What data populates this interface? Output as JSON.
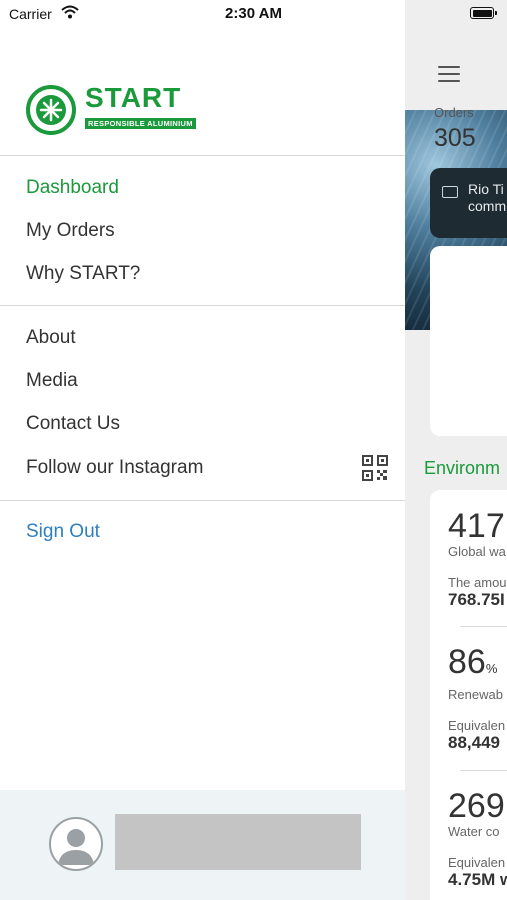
{
  "status_bar": {
    "carrier": "Carrier",
    "time": "2:30 AM"
  },
  "drawer": {
    "logo": {
      "name": "START",
      "tagline": "RESPONSIBLE ALUMINIUM",
      "brand_color": "#1a9a3a"
    },
    "primary_items": [
      {
        "label": "Dashboard",
        "active": true
      },
      {
        "label": "My Orders"
      },
      {
        "label": "Why START?"
      }
    ],
    "secondary_items": [
      {
        "label": "About"
      },
      {
        "label": "Media"
      },
      {
        "label": "Contact Us"
      },
      {
        "label": "Follow our Instagram",
        "icon": "qr-code-icon"
      }
    ],
    "sign_out": {
      "label": "Sign Out",
      "color": "#2f7fbf"
    }
  },
  "background": {
    "banner_text": [
      "Rio Ti",
      "comm"
    ],
    "orders": {
      "label": "Orders",
      "value": "305"
    },
    "environment_title": "Environm",
    "stats": [
      {
        "big": "417",
        "unit": "",
        "sub": "Global wa",
        "label": "The amou",
        "value": "768.75I"
      },
      {
        "big": "86",
        "unit": "%",
        "sub": "Renewab",
        "label": "Equivalen",
        "value": "88,449"
      },
      {
        "big": "269",
        "unit": "",
        "sub": "Water co",
        "label": "Equivalen",
        "value": "4.75M w"
      }
    ]
  }
}
